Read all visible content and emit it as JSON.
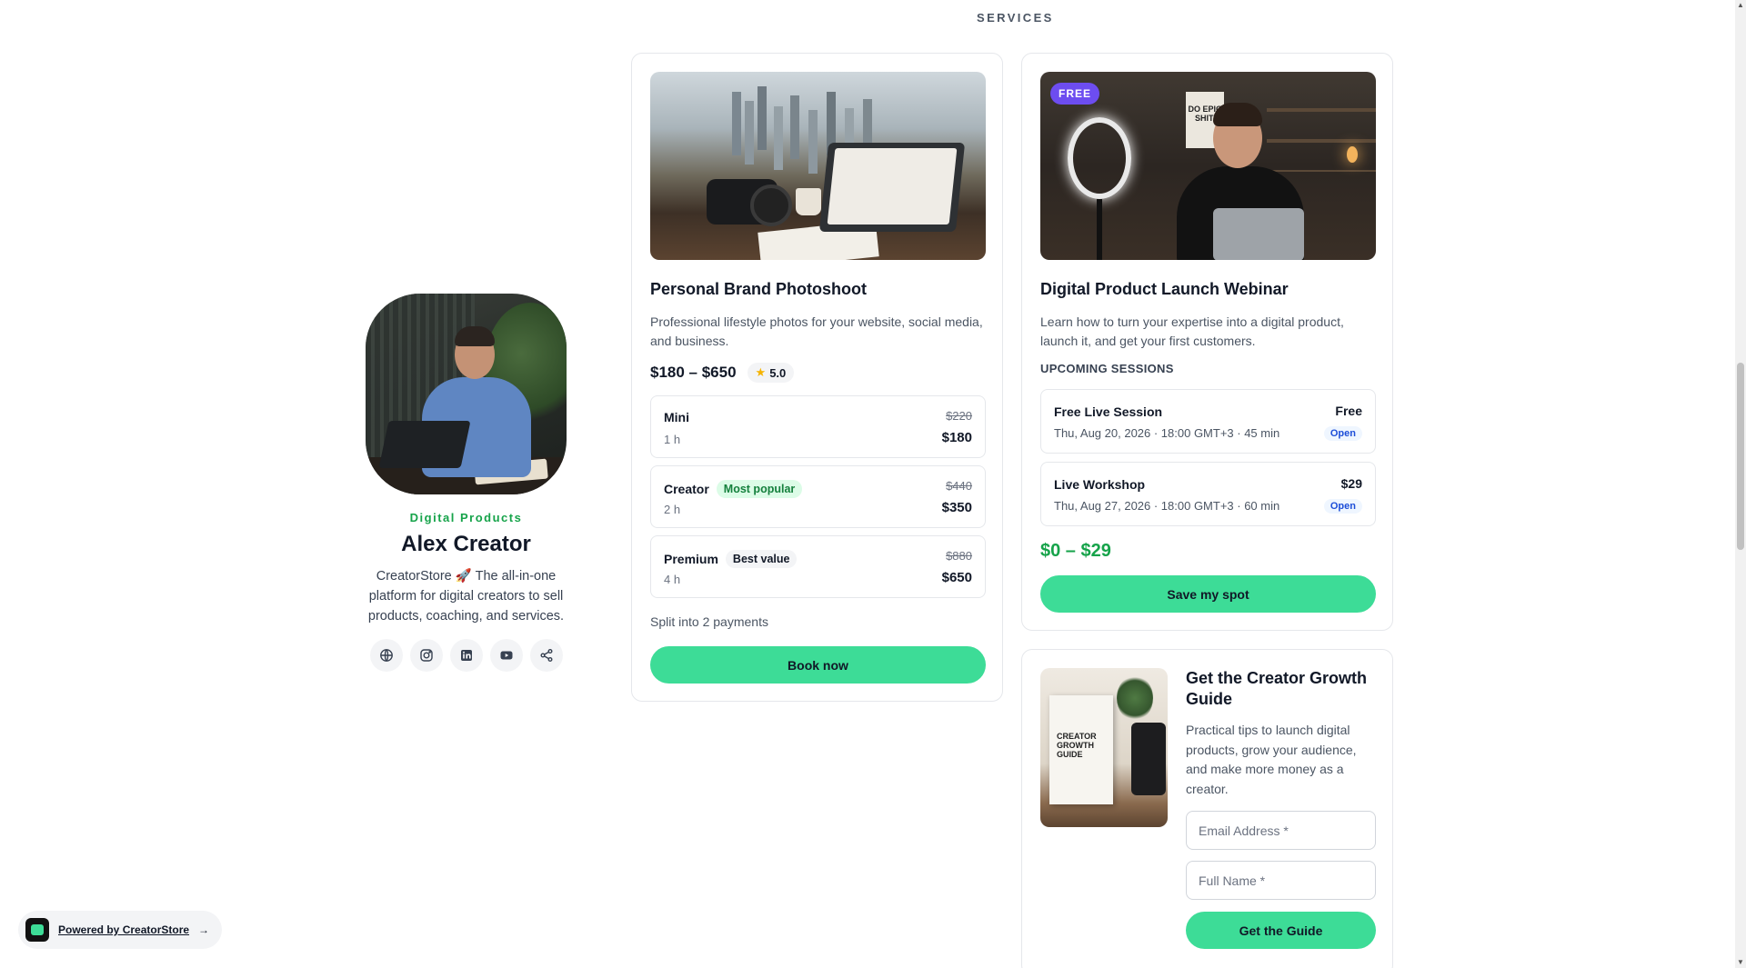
{
  "section": {
    "title": "SERVICES"
  },
  "profile": {
    "category": "Digital Products",
    "name": "Alex Creator",
    "bio": "CreatorStore 🚀 The all-in-one platform for digital creators to sell products, coaching, and services.",
    "socials": [
      "globe-icon",
      "instagram-icon",
      "linkedin-icon",
      "youtube-icon",
      "share-icon"
    ]
  },
  "photoshoot": {
    "title": "Personal Brand Photoshoot",
    "description": "Professional lifestyle photos for your website, social media, and business.",
    "price_range": "$180 – $650",
    "rating": "5.0",
    "tiers": [
      {
        "name": "Mini",
        "duration": "1 h",
        "old_price": "$220",
        "price": "$180",
        "tag": ""
      },
      {
        "name": "Creator",
        "duration": "2 h",
        "old_price": "$440",
        "price": "$350",
        "tag": "Most popular"
      },
      {
        "name": "Premium",
        "duration": "4 h",
        "old_price": "$880",
        "price": "$650",
        "tag": "Best value"
      }
    ],
    "split": "Split into 2 payments",
    "cta": "Book now"
  },
  "webinar": {
    "badge": "FREE",
    "poster_text": "DO EPIC SHIT.",
    "title": "Digital Product Launch Webinar",
    "description": "Learn how to turn your expertise into a digital product, launch it, and get your first customers.",
    "sessions_label": "UPCOMING SESSIONS",
    "sessions": [
      {
        "name": "Free Live Session",
        "info": "Thu, Aug 20, 2026 · 18:00 GMT+3 · 45 min",
        "price": "Free",
        "status": "Open"
      },
      {
        "name": "Live Workshop",
        "info": "Thu, Aug 27, 2026 · 18:00 GMT+3 · 60 min",
        "price": "$29",
        "status": "Open"
      }
    ],
    "price_range": "$0 – $29",
    "cta": "Save my spot"
  },
  "guide": {
    "cover_text": "CREATOR GROWTH GUIDE",
    "title": "Get the Creator Growth Guide",
    "description": "Practical tips to launch digital products, grow your audience, and make more money as a creator.",
    "email_placeholder": "Email Address *",
    "name_placeholder": "Full Name *",
    "cta": "Get the Guide"
  },
  "powered": {
    "label": "Powered by CreatorStore",
    "arrow": "→"
  },
  "colors": {
    "accent": "#3ddc97",
    "brand_green": "#16a34a",
    "badge_purple": "#6d4df0"
  }
}
